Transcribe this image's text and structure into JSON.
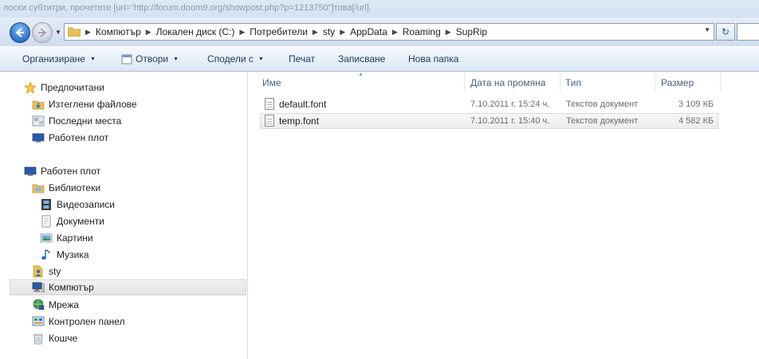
{
  "background_text": "лоски субтитри, прочетете [url=\"http://forum.doom9.org/showpost.php?p=1213750\"]това[/url].",
  "address_bar": {
    "crumbs": [
      "Компютър",
      "Локален диск (C:)",
      "Потребители",
      "sty",
      "AppData",
      "Roaming",
      "SupRip"
    ]
  },
  "toolbar": {
    "organize": "Организиране",
    "open": "Отвори",
    "share": "Сподели с",
    "print": "Печат",
    "burn": "Записване",
    "new_folder": "Нова папка"
  },
  "nav": {
    "favorites": "Предпочитани",
    "downloads": "Изтеглени файлове",
    "recent": "Последни места",
    "desktop_fav": "Работен плот",
    "desktop": "Работен плот",
    "libraries": "Библиотеки",
    "videos": "Видеозаписи",
    "documents": "Документи",
    "pictures": "Картини",
    "music": "Музика",
    "user": "sty",
    "computer": "Компютър",
    "network": "Мрежа",
    "control_panel": "Контролен панел",
    "recycle_bin": "Кошче"
  },
  "columns": {
    "name": "Име",
    "date": "Дата на промяна",
    "type": "Тип",
    "size": "Размер"
  },
  "files": [
    {
      "name": "default.font",
      "date": "7.10.2011 г. 15:24 ч.",
      "type": "Текстов документ",
      "size": "3 109 КБ"
    },
    {
      "name": "temp.font",
      "date": "7.10.2011 г. 15:40 ч.",
      "type": "Текстов документ",
      "size": "4 582 КБ"
    }
  ],
  "colors": {
    "accent": "#1e395b",
    "selection": "#e4e4e4"
  }
}
